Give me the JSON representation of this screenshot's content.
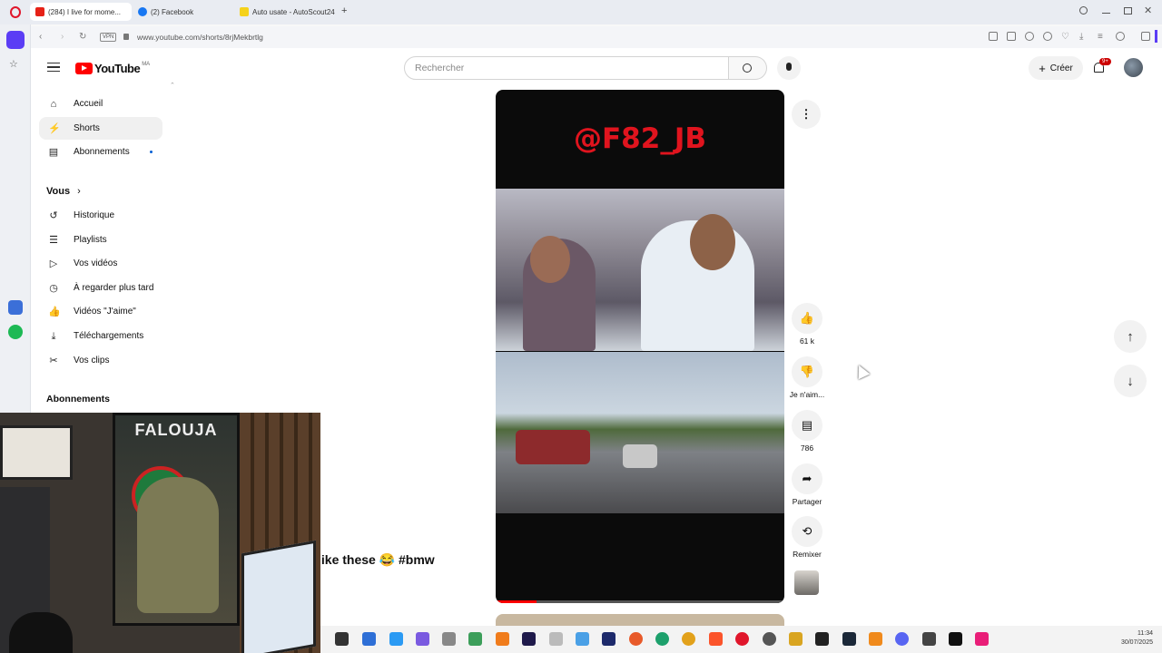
{
  "browser": {
    "tabs": [
      {
        "title": "(284) I live for mome...",
        "color": "#e62117",
        "active": true
      },
      {
        "title": "(2) Facebook",
        "color": "#1877f2",
        "active": false
      },
      {
        "title": "Auto usate - AutoScout24",
        "color": "#f5d21b",
        "active": false
      }
    ],
    "new_tab": "+",
    "url": "www.youtube.com/shorts/8rjMekbrtlg",
    "vpn": "VPN"
  },
  "youtube": {
    "logo_text": "YouTube",
    "region": "MA",
    "search_placeholder": "Rechercher",
    "create_label": "Créer",
    "notif_badge": "9+",
    "sidebar": {
      "main": [
        {
          "label": "Accueil",
          "icon": "home-icon",
          "glyph": "⌂"
        },
        {
          "label": "Shorts",
          "icon": "shorts-icon",
          "glyph": "⚡"
        },
        {
          "label": "Abonnements",
          "icon": "subscriptions-icon",
          "glyph": "▤"
        }
      ],
      "you_header": "Vous",
      "you": [
        {
          "label": "Historique",
          "icon": "history-icon",
          "glyph": "↺"
        },
        {
          "label": "Playlists",
          "icon": "playlists-icon",
          "glyph": "☰"
        },
        {
          "label": "Vos vidéos",
          "icon": "your-videos-icon",
          "glyph": "▷"
        },
        {
          "label": "À regarder plus tard",
          "icon": "watch-later-icon",
          "glyph": "◷"
        },
        {
          "label": "Vidéos \"J'aime\"",
          "icon": "liked-icon",
          "glyph": "👍"
        },
        {
          "label": "Téléchargements",
          "icon": "download-icon",
          "glyph": "⤓"
        },
        {
          "label": "Vos clips",
          "icon": "clips-icon",
          "glyph": "✂"
        }
      ],
      "subscriptions_header": "Abonnements"
    },
    "short": {
      "overlay_text": "@F82_JB",
      "caption": "like these 😂 #bmw",
      "actions": {
        "like_count": "61 k",
        "dislike_label": "Je n'aim...",
        "comments_count": "786",
        "share_label": "Partager",
        "remix_label": "Remixer"
      }
    }
  },
  "webcam": {
    "poster_text": "FALOUJA"
  },
  "taskbar": {
    "time": "11:34",
    "date": "30/07/2025"
  }
}
